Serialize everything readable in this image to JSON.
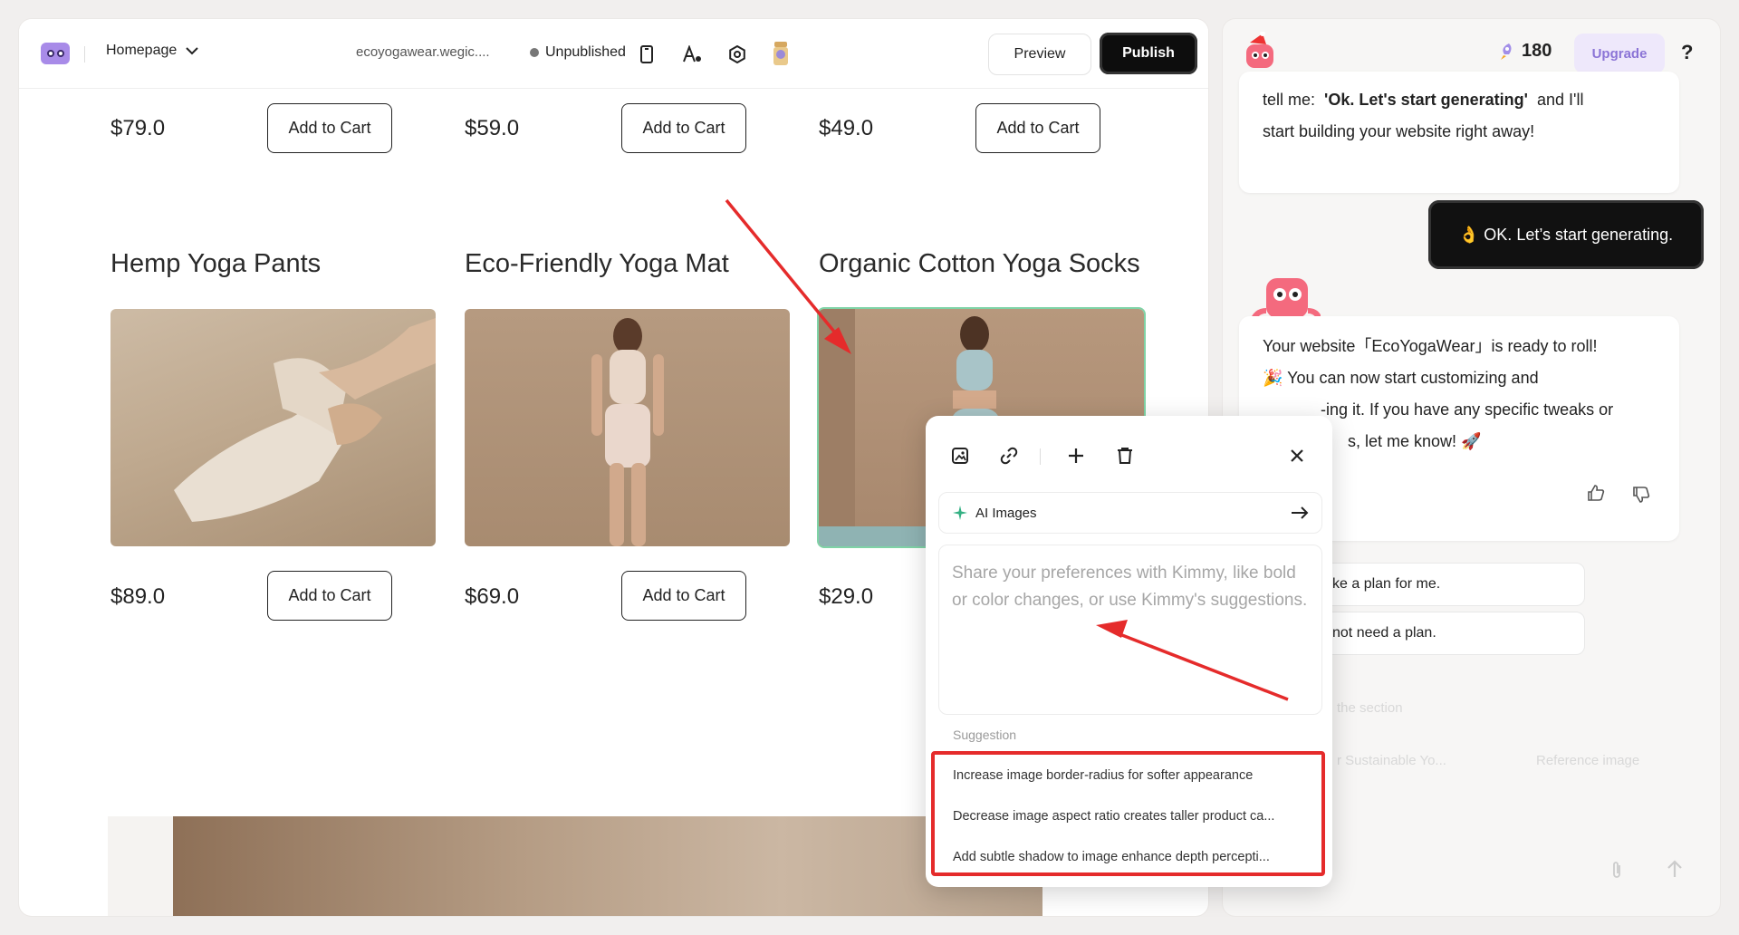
{
  "topbar": {
    "page_name": "Homepage",
    "domain": "ecoyogawear.wegic....",
    "status": "Unpublished",
    "preview_label": "Preview",
    "publish_label": "Publish"
  },
  "products_row1": [
    {
      "price": "$79.0",
      "button": "Add to Cart"
    },
    {
      "price": "$59.0",
      "button": "Add to Cart"
    },
    {
      "price": "$49.0",
      "button": "Add to Cart"
    }
  ],
  "products_row2": [
    {
      "title": "Hemp Yoga Pants",
      "price": "$89.0",
      "button": "Add to Cart"
    },
    {
      "title": "Eco-Friendly Yoga Mat",
      "price": "$69.0",
      "button": "Add to Cart"
    },
    {
      "title": "Organic Cotton Yoga Socks",
      "price": "$29.0"
    }
  ],
  "popup": {
    "ai_images_label": "AI Images",
    "placeholder": "Share your preferences with Kimmy, like bold or color changes, or use Kimmy's suggestions.",
    "suggestion_label": "Suggestion",
    "suggestions": [
      "Increase image border-radius for softer appearance",
      "Decrease image aspect ratio creates taller product ca...",
      "Add subtle shadow to image enhance depth percepti..."
    ]
  },
  "chat": {
    "credits": "180",
    "upgrade_label": "Upgrade",
    "help_label": "?",
    "msg1_prefix": "tell me:",
    "msg1_bold": "'Ok. Let's start generating'",
    "msg1_suffix": "and I'll",
    "msg1_line2": "start building your website right away!",
    "user_msg": "👌 OK. Let’s start generating.",
    "msg2_line1": "Your website「EcoYogaWear」is ready to roll!",
    "msg2_line2": "🎉 You can now start customizing and",
    "msg2_line3": "-ing it. If you have any specific tweaks or",
    "msg2_line4": "s, let me know! 🚀",
    "chip1": "ke a plan for me.",
    "chip2": "not need a plan.",
    "faded1": "the section",
    "faded2": "r Sustainable Yo...",
    "faded3": "Reference image"
  }
}
